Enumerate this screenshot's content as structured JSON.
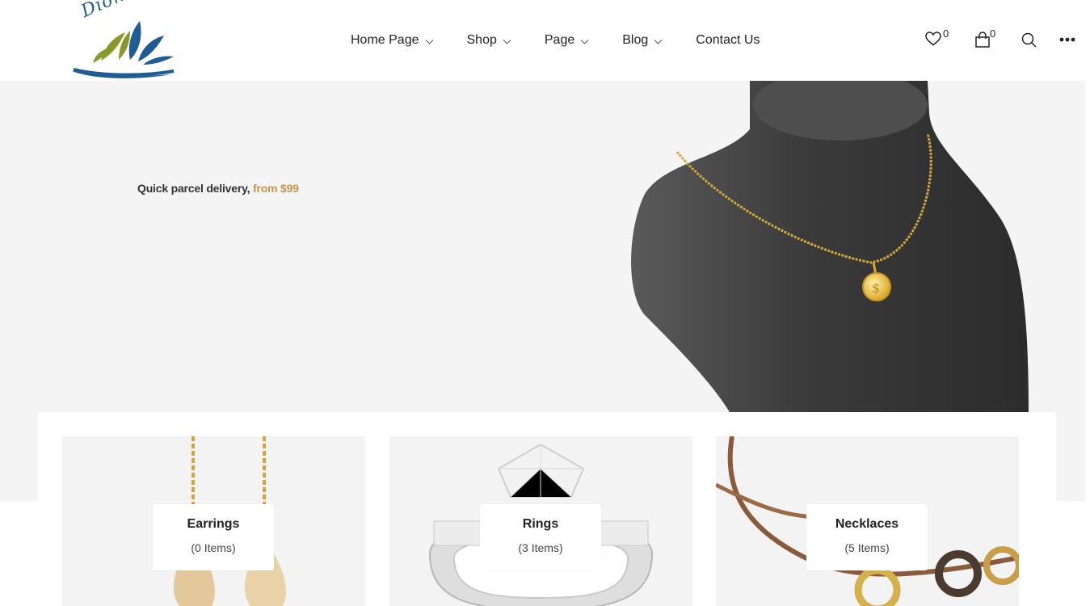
{
  "brand": {
    "logo_text": "Dion Mart"
  },
  "nav": {
    "items": [
      {
        "label": "Home Page",
        "has_dropdown": true
      },
      {
        "label": "Shop",
        "has_dropdown": true
      },
      {
        "label": "Page",
        "has_dropdown": true
      },
      {
        "label": "Blog",
        "has_dropdown": true
      },
      {
        "label": "Contact Us",
        "has_dropdown": false
      }
    ]
  },
  "header_icons": {
    "wishlist": {
      "icon": "heart-icon",
      "count": "0"
    },
    "cart": {
      "icon": "shopping-bag-icon",
      "count": "0"
    },
    "search": {
      "icon": "search-icon"
    },
    "more": {
      "icon": "more-dots-icon"
    }
  },
  "hero": {
    "tagline": "Quick parcel delivery,",
    "tagline_accent": "from $99",
    "accent_color": "#c5944e"
  },
  "categories": [
    {
      "title": "Earrings",
      "count": "(0 Items)"
    },
    {
      "title": "Rings",
      "count": "(3 Items)"
    },
    {
      "title": "Necklaces",
      "count": "(5 Items)"
    }
  ],
  "colors": {
    "hero_bg": "#f4f4f4",
    "card_bg": "#f3f3f3",
    "logo_blue": "#1f5c95",
    "logo_olive": "#8a9a2a"
  }
}
